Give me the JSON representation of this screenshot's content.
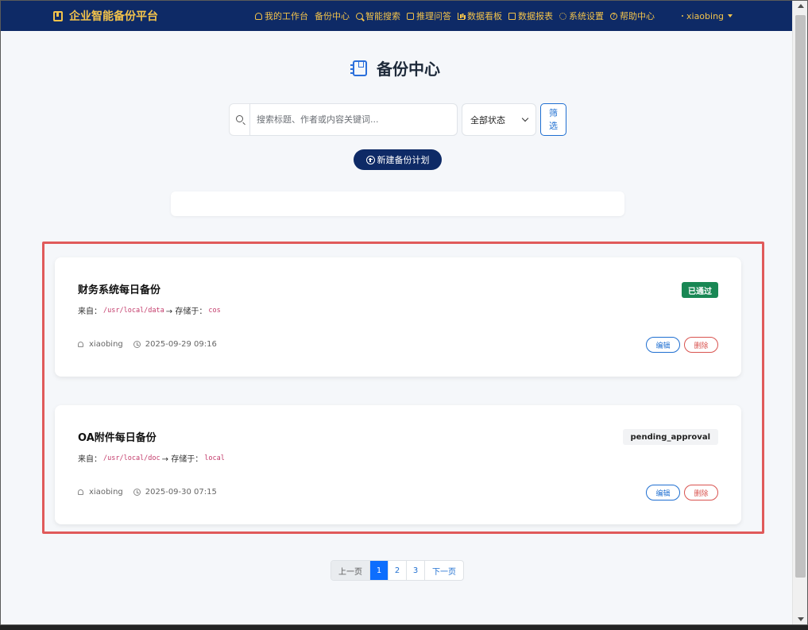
{
  "navbar": {
    "brand": "企业智能备份平台",
    "links": [
      "我的工作台",
      "备份中心",
      "智能搜索",
      "推理问答",
      "数据看板",
      "数据报表",
      "系统设置",
      "帮助中心"
    ],
    "username": "xiaobing"
  },
  "page": {
    "title": "备份中心",
    "search_placeholder": "搜索标题、作者或内容关键词...",
    "status_select": "全部状态",
    "filter_button": "筛选",
    "new_plan_button": "新建备份计划"
  },
  "cards": [
    {
      "title": "财务系统每日备份",
      "from_label": "来自：",
      "source": "/usr/local/data",
      "arrow_label": "→ 存储于：",
      "target": "cos",
      "status": "已通过",
      "author": "xiaobing",
      "time": "2025-09-29 09:16",
      "edit": "编辑",
      "delete": "删除"
    },
    {
      "title": "OA附件每日备份",
      "from_label": "来自：",
      "source": "/usr/local/doc",
      "arrow_label": "→ 存储于：",
      "target": "local",
      "status": "pending_approval",
      "author": "xiaobing",
      "time": "2025-09-30 07:15",
      "edit": "编辑",
      "delete": "删除"
    }
  ],
  "pagination": {
    "prev": "上一页",
    "pages": [
      "1",
      "2",
      "3"
    ],
    "next": "下一页",
    "current": "1"
  },
  "colors": {
    "navbar": "#0e2a66",
    "nav_text": "#f3c34b",
    "approved": "#198754",
    "highlight": "#e05a5a"
  }
}
